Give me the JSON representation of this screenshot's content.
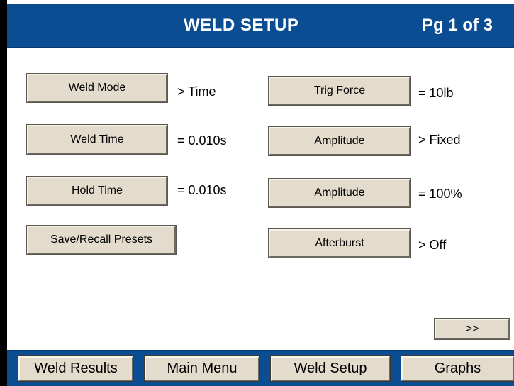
{
  "header": {
    "title": "WELD SETUP",
    "page": "Pg 1 of 3"
  },
  "left_column": [
    {
      "label": "Weld Mode",
      "value": "> Time"
    },
    {
      "label": "Weld Time",
      "value": "= 0.010s"
    },
    {
      "label": "Hold Time",
      "value": "= 0.010s"
    },
    {
      "label": "Save/Recall Presets",
      "value": ""
    }
  ],
  "right_column": [
    {
      "label": "Trig Force",
      "value": "= 10lb"
    },
    {
      "label": "Amplitude",
      "value": "> Fixed"
    },
    {
      "label": "Amplitude",
      "value": "= 100%"
    },
    {
      "label": "Afterburst",
      "value": "> Off"
    }
  ],
  "next_button": ">>",
  "footer": {
    "tabs": [
      "Weld Results",
      "Main Menu",
      "Weld Setup",
      "Graphs"
    ]
  },
  "colors": {
    "header_blue": "#0b4d92",
    "button_face": "#e3dccd",
    "frame": "#000000"
  }
}
